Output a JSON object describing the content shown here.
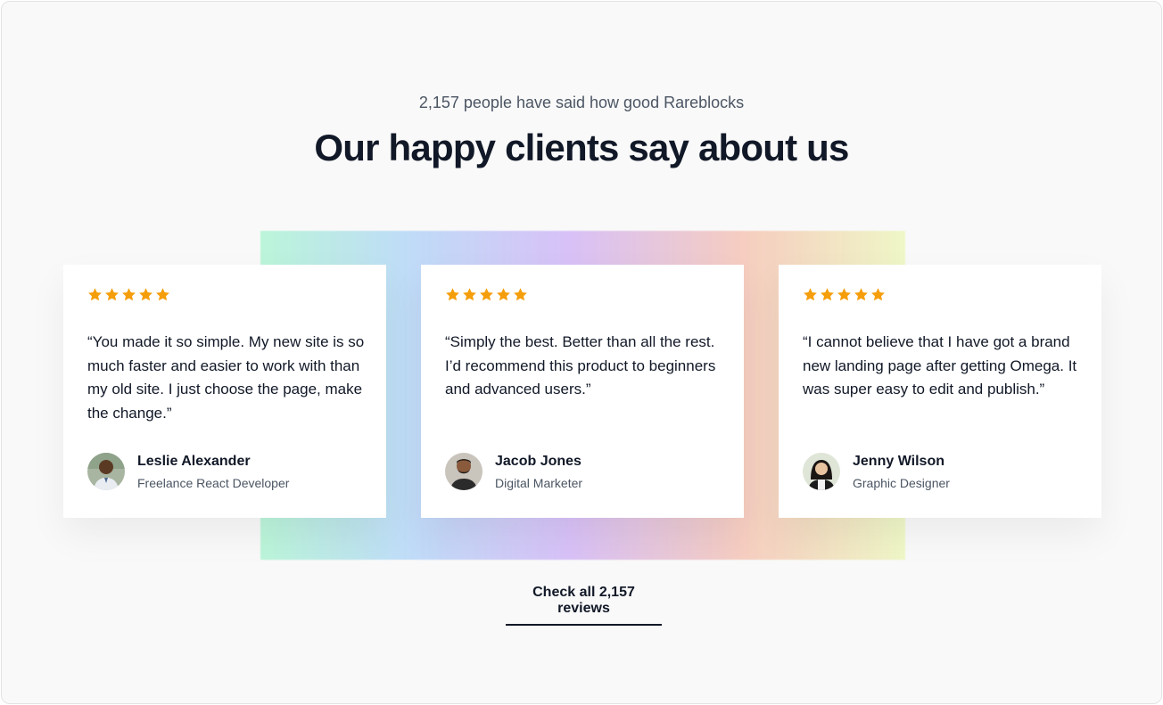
{
  "header": {
    "subtitle": "2,157 people have said how good Rareblocks",
    "title": "Our happy clients say about us"
  },
  "colors": {
    "star": "#f59e0b",
    "text_primary": "#111827",
    "text_secondary": "#4b5563"
  },
  "testimonials": [
    {
      "rating": 5,
      "quote": "“You made it so simple. My new site is so much faster and easier to work with than my old site. I just choose the page, make the change.”",
      "name": "Leslie Alexander",
      "role": "Freelance React Developer",
      "avatar_icon": "person-avatar"
    },
    {
      "rating": 5,
      "quote": "“Simply the best. Better than all the rest. I’d recommend this product to beginners and advanced users.”",
      "name": "Jacob Jones",
      "role": "Digital Marketer",
      "avatar_icon": "person-avatar"
    },
    {
      "rating": 5,
      "quote": "“I cannot believe that I have got a brand new landing page after getting Omega. It was super easy to edit and publish.”",
      "name": "Jenny Wilson",
      "role": "Graphic Designer",
      "avatar_icon": "person-avatar"
    }
  ],
  "footer": {
    "link_label": "Check all 2,157 reviews"
  }
}
